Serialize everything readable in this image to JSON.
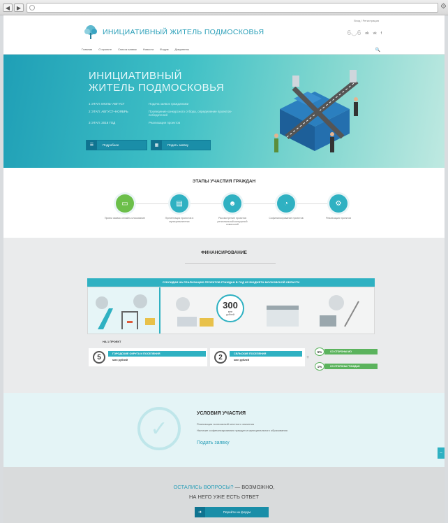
{
  "header": {
    "login": "Вход / Регистрация",
    "brand": "ИНИЦИАТИВНЫЙ ЖИТЕЛЬ ПОДМОСКОВЬЯ",
    "social": [
      "ok-icon",
      "vk-icon",
      "fb-icon"
    ]
  },
  "menu": {
    "items": [
      "Главная",
      "О проекте",
      "Список заявок",
      "Новости",
      "Форум",
      "Документы"
    ]
  },
  "hero": {
    "title_line1": "ИНИЦИАТИВНЫЙ",
    "title_line2": "ЖИТЕЛЬ ПОДМОСКОВЬЯ",
    "steps": [
      {
        "period": "1 ЭТАП: ИЮЛЬ–АВГУСТ",
        "desc": "Подача заявок гражданами"
      },
      {
        "period": "2 ЭТАП: АВГУСТ–НОЯБРЬ",
        "desc": "Проведение конкурсного отбора, определение проектов-победителей"
      },
      {
        "period": "3 ЭТАП: 2018 ГОД",
        "desc": "Реализация проектов"
      }
    ],
    "btn_more": "Подробнее",
    "btn_apply": "Подать заявку"
  },
  "stages": {
    "title": "ЭТАПЫ УЧАСТИЯ ГРАЖДАН",
    "items": [
      {
        "label": "Прием заявок онлайн-голосование",
        "color": "#6cbf4a"
      },
      {
        "label": "Презентация проектов в муниципалитетах",
        "color": "#2fb1c2"
      },
      {
        "label": "Рассмотрение проектов региональной конкурсной комиссией",
        "color": "#2fb1c2"
      },
      {
        "label": "Софинансирование проектов",
        "color": "#2fb1c2"
      },
      {
        "label": "Реализация проектов",
        "color": "#2fb1c2"
      }
    ]
  },
  "finance": {
    "title": "ФИНАНСИРОВАНИЕ",
    "banner": "СУБСИДИИ НА РЕАЛИЗАЦИЮ ПРОЕКТОВ ГРАЖДАН В ГОД ИЗ БЮДЖЕТА МОСКОВСКОЙ ОБЛАСТИ",
    "amount": "300",
    "amount_unit1": "млн",
    "amount_unit2": "рублей",
    "per_project": "НА 1 ПРОЕКТ",
    "tiers": [
      {
        "num": "5",
        "label": "ГОРОДСКИЕ ОКРУГА И ПОСЕЛЕНИЯ",
        "unit": "млн рублей"
      },
      {
        "num": "2",
        "label": "СЕЛЬСКИЕ ПОСЕЛЕНИЯ",
        "unit": "млн рублей"
      }
    ],
    "shares": [
      {
        "pct": "5%",
        "label": "СО СТОРОНЫ МО"
      },
      {
        "pct": "1%",
        "label": "СО СТОРОНЫ ГРАЖДАН"
      }
    ]
  },
  "conditions": {
    "title": "УСЛОВИЯ УЧАСТИЯ",
    "line1": "Реализация полномочий местного значения",
    "line2": "Наличие софинансирования граждан и муниципального образования",
    "link": "Подать заявку"
  },
  "faq": {
    "highlight": "ОСТАЛИСЬ ВОПРОСЫ?",
    "rest": " — ВОЗМОЖНО,",
    "line2": "НА НЕГО УЖЕ ЕСТЬ ОТВЕТ",
    "btn": "Перейти на форум"
  }
}
